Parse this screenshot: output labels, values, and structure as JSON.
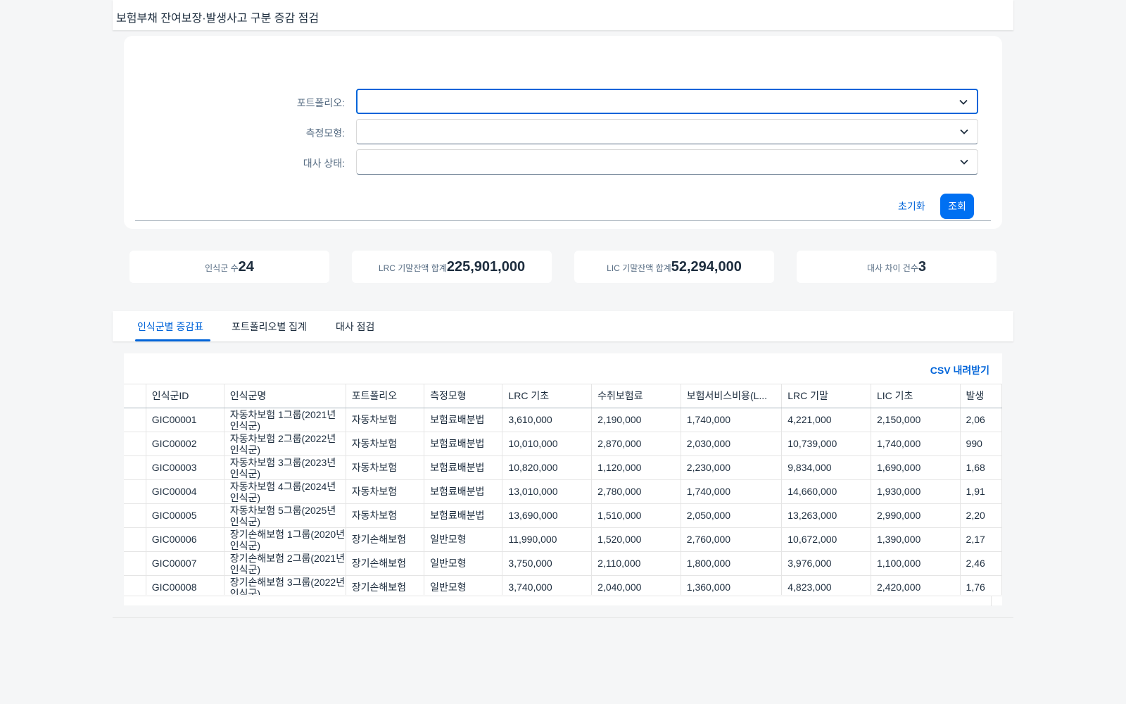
{
  "header": {
    "title": "보험부채 잔여보장·발생사고 구분 증감 점검"
  },
  "filters": {
    "portfolio": {
      "label": "포트폴리오:",
      "value": ""
    },
    "model": {
      "label": "측정모형:",
      "value": ""
    },
    "status": {
      "label": "대사 상태:",
      "value": ""
    },
    "reset_label": "초기화",
    "search_label": "조회"
  },
  "kpis": [
    {
      "label": "인식군 수",
      "value": "24"
    },
    {
      "label": "LRC 기말잔액 합계",
      "value": "225,901,000"
    },
    {
      "label": "LIC 기말잔액 합계",
      "value": "52,294,000"
    },
    {
      "label": "대사 차이 건수",
      "value": "3"
    }
  ],
  "tabs": [
    {
      "label": "인식군별 증감표",
      "active": true
    },
    {
      "label": "포트폴리오별 집계",
      "active": false
    },
    {
      "label": "대사 점검",
      "active": false
    }
  ],
  "table": {
    "csv_label": "CSV 내려받기",
    "columns": [
      "인식군ID",
      "인식군명",
      "포트폴리오",
      "측정모형",
      "LRC 기초",
      "수취보험료",
      "보험서비스비용(L...",
      "LRC 기말",
      "LIC 기초",
      "발생"
    ],
    "rows": [
      [
        "GIC00001",
        "자동차보험 1그룹(2021년 인식군)",
        "자동차보험",
        "보험료배분법",
        "3,610,000",
        "2,190,000",
        "1,740,000",
        "4,221,000",
        "2,150,000",
        "2,06"
      ],
      [
        "GIC00002",
        "자동차보험 2그룹(2022년 인식군)",
        "자동차보험",
        "보험료배분법",
        "10,010,000",
        "2,870,000",
        "2,030,000",
        "10,739,000",
        "1,740,000",
        "990"
      ],
      [
        "GIC00003",
        "자동차보험 3그룹(2023년 인식군)",
        "자동차보험",
        "보험료배분법",
        "10,820,000",
        "1,120,000",
        "2,230,000",
        "9,834,000",
        "1,690,000",
        "1,68"
      ],
      [
        "GIC00004",
        "자동차보험 4그룹(2024년 인식군)",
        "자동차보험",
        "보험료배분법",
        "13,010,000",
        "2,780,000",
        "1,740,000",
        "14,660,000",
        "1,930,000",
        "1,91"
      ],
      [
        "GIC00005",
        "자동차보험 5그룹(2025년 인식군)",
        "자동차보험",
        "보험료배분법",
        "13,690,000",
        "1,510,000",
        "2,050,000",
        "13,263,000",
        "2,990,000",
        "2,20"
      ],
      [
        "GIC00006",
        "장기손해보험 1그룹(2020년 인식군)",
        "장기손해보험",
        "일반모형",
        "11,990,000",
        "1,520,000",
        "2,760,000",
        "10,672,000",
        "1,390,000",
        "2,17"
      ],
      [
        "GIC00007",
        "장기손해보험 2그룹(2021년 인식군)",
        "장기손해보험",
        "일반모형",
        "3,750,000",
        "2,110,000",
        "1,800,000",
        "3,976,000",
        "1,100,000",
        "2,46"
      ],
      [
        "GIC00008",
        "장기손해보험 3그룹(2022년 인식군)",
        "장기손해보험",
        "일반모형",
        "3,740,000",
        "2,040,000",
        "1,360,000",
        "4,823,000",
        "2,420,000",
        "1,76"
      ]
    ]
  },
  "colors": {
    "accent": "#0064d9",
    "primary_button": "#0070f2",
    "text": "#1d2d3e",
    "label": "#556b82"
  },
  "icons": {
    "dropdown": "chevron-down-icon"
  }
}
